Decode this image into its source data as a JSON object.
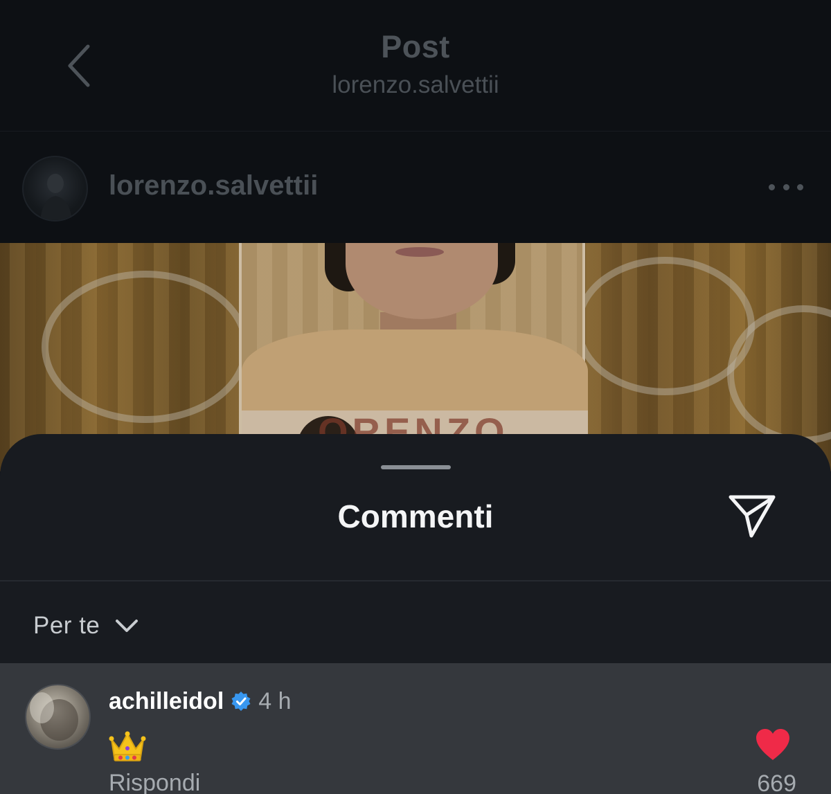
{
  "header": {
    "title": "Post",
    "subtitle": "lorenzo.salvettii",
    "back_icon": "chevron-left-icon"
  },
  "post": {
    "author": "lorenzo.salvettii",
    "more_icon": "more-horizontal-icon",
    "image_text": "ORENZO"
  },
  "comments_sheet": {
    "title": "Commenti",
    "share_icon": "send-icon",
    "sort": {
      "label": "Per te",
      "icon": "chevron-down-icon"
    },
    "comments": [
      {
        "username": "achilleidol",
        "verified": true,
        "time": "4 h",
        "text_emoji": "crown-emoji",
        "reply_label": "Rispondi",
        "liked": true,
        "like_count": "669"
      }
    ]
  },
  "colors": {
    "background": "#0c0f13",
    "sheet": "#181b20",
    "comment_highlight": "#35383d",
    "like_red": "#ef2a48",
    "verified_blue": "#3897f0"
  }
}
